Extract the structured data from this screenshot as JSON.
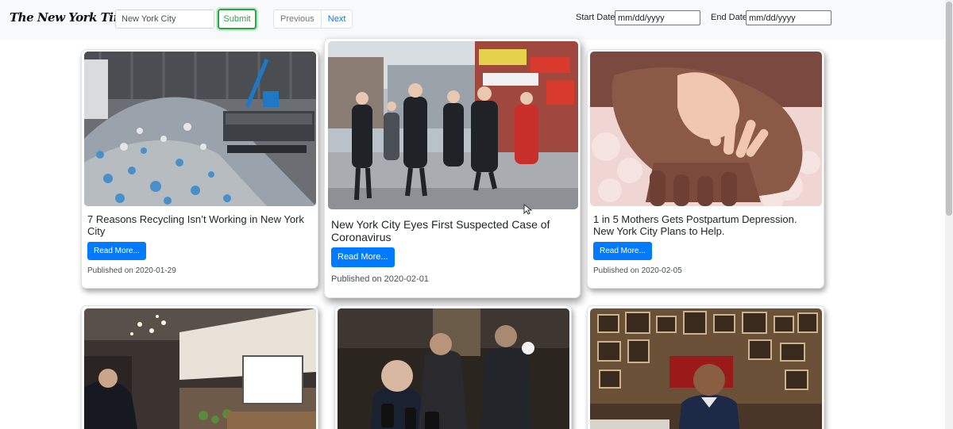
{
  "header": {
    "logo": "The New York Times",
    "search_value": "New York City",
    "submit_label": "Submit",
    "prev_label": "Previous",
    "next_label": "Next",
    "start_label": "Start Date:",
    "start_value": "mm/dd/yyyy",
    "end_label": "End Date:",
    "end_value": "mm/dd/yyyy"
  },
  "articles": [
    {
      "title": "7 Reasons Recycling Isn’t Working in New York City",
      "button": "Read More...",
      "published": "Published on 2020-01-29"
    },
    {
      "title": "New York City Eyes First Suspected Case of Coronavirus",
      "button": "Read More...",
      "published": "Published on 2020-02-01"
    },
    {
      "title": "1 in 5 Mothers Gets Postpartum Depression. New York City Plans to Help.",
      "button": "Read More...",
      "published": "Published on 2020-02-05"
    },
    {
      "title": "",
      "button": "",
      "published": ""
    },
    {
      "title": "",
      "button": "",
      "published": ""
    },
    {
      "title": "",
      "button": "",
      "published": ""
    }
  ],
  "colors": {
    "primary": "#007bff",
    "success": "#28a745",
    "header_bg": "#f8f9fa"
  }
}
